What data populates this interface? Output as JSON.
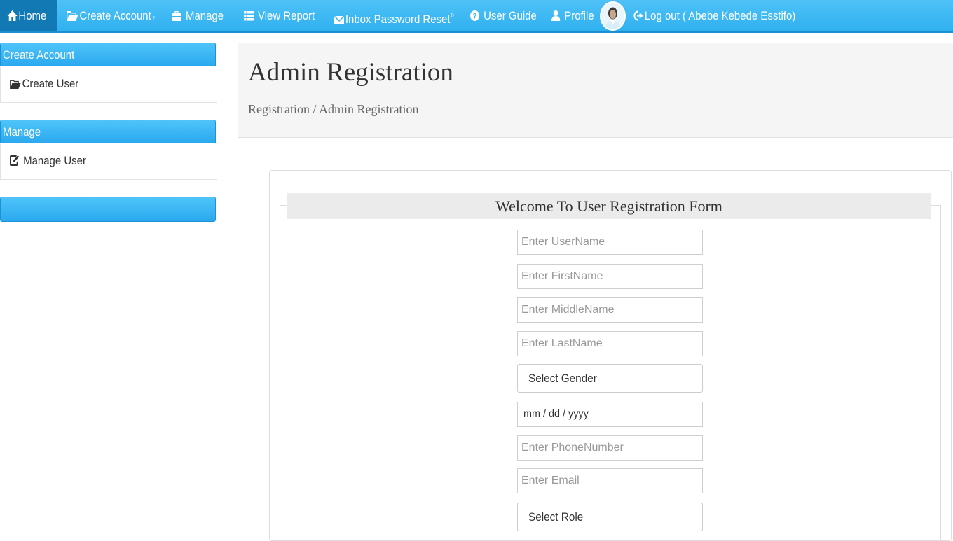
{
  "navbar": {
    "home": "Home",
    "create_account": "Create Account",
    "manage": "Manage",
    "view_report": "View Report",
    "inbox_password_reset": "Inbox Password Reset",
    "inbox_count": "0",
    "user_guide": "User Guide",
    "profile": "Profile",
    "logout": "Log out ( Abebe Kebede Esstifo)"
  },
  "sidebar": {
    "sections": [
      {
        "heading": "Create Account",
        "item": "Create User",
        "icon": "folder-open-icon"
      },
      {
        "heading": "Manage",
        "item": "Manage User",
        "icon": "edit-icon"
      },
      {
        "heading": ""
      }
    ]
  },
  "page": {
    "title": "Admin Registration",
    "breadcrumb": "Registration / Admin Registration"
  },
  "form": {
    "legend": "Welcome To User Registration Form",
    "username_placeholder": "Enter UserName",
    "firstname_placeholder": "Enter FirstName",
    "middlename_placeholder": "Enter MiddleName",
    "lastname_placeholder": "Enter LastName",
    "gender_select": "Select Gender",
    "date_placeholder": "mm / dd / yyyy",
    "phone_placeholder": "Enter PhoneNumber",
    "email_placeholder": "Enter Email",
    "role_select": "Select Role"
  },
  "colors": {
    "navbar": "#2fb1f0",
    "navbar_active": "#1379b5",
    "sidebar_heading": "#2aa9ee"
  }
}
